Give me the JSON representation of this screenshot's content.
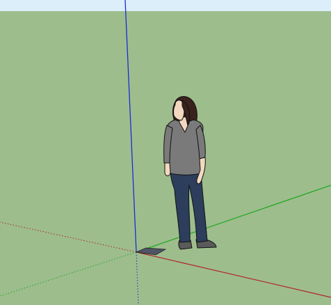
{
  "scene": {
    "sky_color": "#dceef9",
    "ground_color": "#9dbd8d",
    "axis_colors": {
      "red": "#b22222",
      "green": "#1fa81f",
      "blue": "#1c2bd6"
    },
    "figure": {
      "skin": "#f3d8c0",
      "hair": "#3a231c",
      "sweater": "#7a7a7a",
      "jeans": "#2d3d5c",
      "shoes": "#5a5a5a",
      "outline": "#111111"
    },
    "origin_tile_color": "#4d5564"
  }
}
